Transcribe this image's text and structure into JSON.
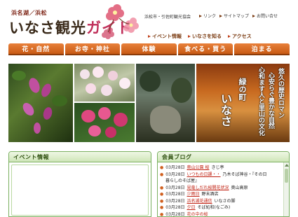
{
  "header": {
    "subtitle": "浜名湖／浜松",
    "logo_main": "いなさ観光",
    "logo_accent": "ガイド",
    "org_name": "浜松市・引佐町観光協会",
    "top_links": [
      "リンク",
      "サイトマップ",
      "お問い合せ"
    ]
  },
  "subnav": [
    "イベント情報",
    "いなさを知る",
    "アクセス"
  ],
  "mainnav": [
    "花・自然",
    "お寺・神社",
    "体験",
    "食べる・買う",
    "泊まる"
  ],
  "hero": {
    "copy_line1": "悠久の歴史ロマン",
    "copy_line2": "心安らぐ豊かな自然",
    "copy_line3": "心和ます人と里山の文化",
    "copy_town": "緑の町",
    "copy_name": "いなさ"
  },
  "events": {
    "heading": "イベント情報"
  },
  "blog": {
    "heading": "会員ブログ",
    "entries": [
      {
        "date": "03月28日",
        "title": "奥山公園 桜",
        "author": "きじ亭"
      },
      {
        "date": "03月28日",
        "title": "いつもの日課・・",
        "author": "乃木そば神谷・『その日"
      },
      {
        "date": "",
        "title": "",
        "author": "暮らしのそば屋』"
      },
      {
        "date": "03月28日",
        "title": "見竜しだれ桜開花状況",
        "author": "奥山高原"
      },
      {
        "date": "03月28日",
        "title": "少雨日",
        "author": "野末酒店"
      },
      {
        "date": "03月28日",
        "title": "浜名湖花通信",
        "author": "いなさの脚"
      },
      {
        "date": "03月28日",
        "title": "夕日",
        "author": "そば処和(なごみ)"
      },
      {
        "date": "03月28日",
        "title": "花の中の桜",
        "author": ""
      }
    ]
  },
  "colors": {
    "nav_orange": "#d8681e",
    "panel_green": "#7ab060",
    "logo_pink": "#c0305a",
    "link_red": "#c02010"
  }
}
